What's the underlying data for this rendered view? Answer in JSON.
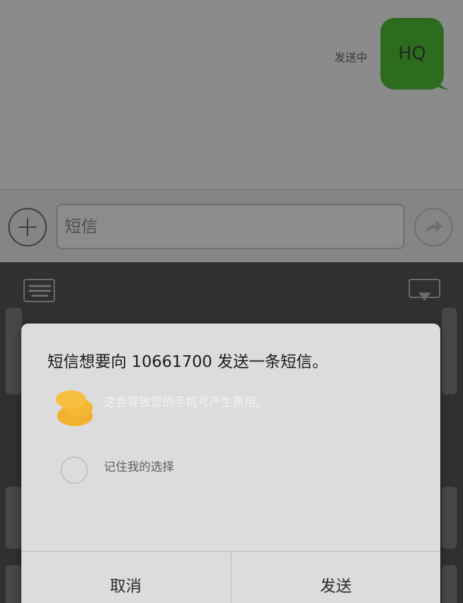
{
  "chat": {
    "status": "发送中",
    "message": "HQ",
    "bubble_color": "#2d6b1f"
  },
  "compose": {
    "placeholder": "短信",
    "attach_icon": "plus-icon",
    "send_icon": "send-arrow-icon"
  },
  "keyboard": {
    "left_icon": "keyboard-icon",
    "right_icon": "hide-keyboard-icon"
  },
  "dialog": {
    "title": "短信想要向 10661700 发送一条短信。",
    "warning": "这会导致您的手机号产生费用。",
    "warning_icon": "coins-icon",
    "remember_label": "记住我的选择",
    "remember_checked": false,
    "cancel_label": "取消",
    "send_label": "发送",
    "accent_color": "#f5b833"
  }
}
